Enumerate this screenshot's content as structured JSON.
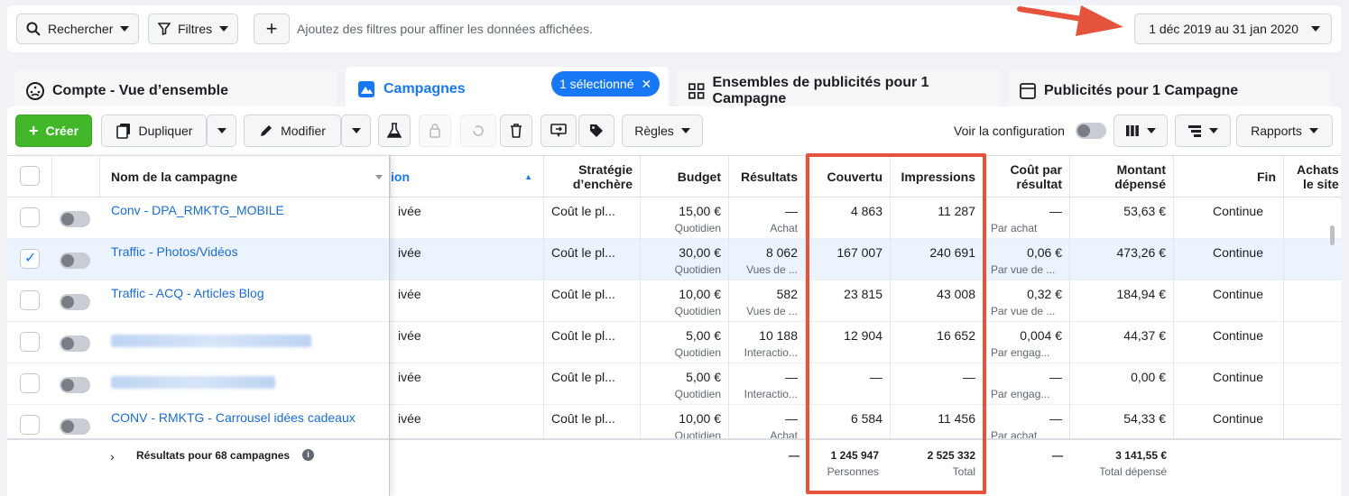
{
  "topbar": {
    "search_label": "Rechercher",
    "filters_label": "Filtres",
    "add_symbol": "+",
    "filter_hint": "Ajoutez des filtres pour affiner les données affichées.",
    "date_range": "1 déc 2019 au 31 jan 2020"
  },
  "tabs": [
    {
      "label": "Compte - Vue d’ensemble"
    },
    {
      "label": "Campagnes",
      "badge": "1 sélectionné"
    },
    {
      "label": "Ensembles de publicités pour 1 Campagne"
    },
    {
      "label": "Publicités pour 1 Campagne"
    }
  ],
  "toolbar": {
    "create": "Créer",
    "duplicate": "Dupliquer",
    "edit": "Modifier",
    "rules": "Règles",
    "view_config": "Voir la configuration",
    "reports": "Rapports"
  },
  "columns": {
    "name": "Nom de la campagne",
    "delivery": "ion",
    "strategy": [
      "Stratégie",
      "d’enchère"
    ],
    "budget": "Budget",
    "results": "Résultats",
    "reach": "Couvertu",
    "impressions": "Impressions",
    "cpr": [
      "Coût par",
      "résultat"
    ],
    "spent": [
      "Montant",
      "dépensé"
    ],
    "end": "Fin",
    "purchases": [
      "Achats",
      "le site"
    ]
  },
  "rows": [
    {
      "name": "Conv - DPA_RMKTG_MOBILE",
      "delivery": "ivée",
      "strategy": "Coût le pl...",
      "budget": "15,00 €",
      "budget_sub": "Quotidien",
      "results": "—",
      "results_sub": "Achat",
      "reach": "4 863",
      "impressions": "11 287",
      "cpr": "—",
      "cpr_sub": "Par achat",
      "spent": "53,63 €",
      "end": "Continue"
    },
    {
      "name": "Traffic - Photos/Vidéos",
      "delivery": "ivée",
      "strategy": "Coût le pl...",
      "budget": "30,00 €",
      "budget_sub": "Quotidien",
      "results": "8 062",
      "results_sub": "Vues de ...",
      "reach": "167 007",
      "impressions": "240 691",
      "cpr": "0,06 €",
      "cpr_sub": "Par vue de ...",
      "spent": "473,26 €",
      "end": "Continue"
    },
    {
      "name": "Traffic - ACQ - Articles Blog",
      "delivery": "ivée",
      "strategy": "Coût le pl...",
      "budget": "10,00 €",
      "budget_sub": "Quotidien",
      "results": "582",
      "results_sub": "Vues de ...",
      "reach": "23 815",
      "impressions": "43 008",
      "cpr": "0,32 €",
      "cpr_sub": "Par vue de ...",
      "spent": "184,94 €",
      "end": "Continue"
    },
    {
      "name": "",
      "delivery": "ivée",
      "strategy": "Coût le pl...",
      "budget": "5,00 €",
      "budget_sub": "Quotidien",
      "results": "10 188",
      "results_sub": "Interactio...",
      "reach": "12 904",
      "impressions": "16 652",
      "cpr": "0,004 €",
      "cpr_sub": "Par engag...",
      "spent": "44,37 €",
      "end": "Continue"
    },
    {
      "name": "",
      "delivery": "ivée",
      "strategy": "Coût le pl...",
      "budget": "5,00 €",
      "budget_sub": "Quotidien",
      "results": "—",
      "results_sub": "Interactio...",
      "reach": "—",
      "impressions": "—",
      "cpr": "—",
      "cpr_sub": "Par engag...",
      "spent": "0,00 €",
      "end": "Continue"
    },
    {
      "name": "CONV - RMKTG - Carrousel idées cadeaux",
      "delivery": "ivée",
      "strategy": "Coût le pl...",
      "budget": "10,00 €",
      "budget_sub": "Quotidien",
      "results": "—",
      "results_sub": "Achat",
      "reach": "6 584",
      "impressions": "11 456",
      "cpr": "—",
      "cpr_sub": "Par achat",
      "spent": "54,33 €",
      "end": "Continue"
    }
  ],
  "footer": {
    "label": "Résultats pour 68 campagnes",
    "results": "—",
    "reach": "1 245 947",
    "reach_sub": "Personnes",
    "impressions": "2 525 332",
    "impressions_sub": "Total",
    "cpr": "—",
    "spent": "3 141,55 €",
    "spent_sub": "Total dépensé"
  },
  "colors": {
    "accent": "#1877f2",
    "create": "#42b72a",
    "highlight": "#e6533c"
  }
}
